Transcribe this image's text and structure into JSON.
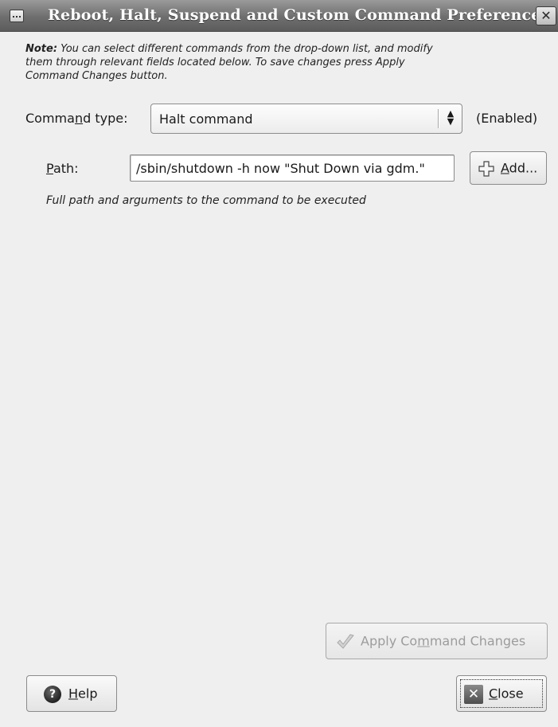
{
  "window": {
    "title": "Reboot, Halt, Suspend and Custom Command Preferences",
    "close_glyph": "✕"
  },
  "note": {
    "bold": "Note:",
    "text": " You can select different commands from the drop-down list, and modify them through relevant fields located below. To save changes press Apply Command Changes button."
  },
  "command_type": {
    "label_pre": "Comma",
    "label_mnemonic": "n",
    "label_post": "d type:",
    "selected": "Halt command",
    "status": "(Enabled)"
  },
  "path": {
    "label_mnemonic": "P",
    "label_post": "ath:",
    "value": "/sbin/shutdown -h now \"Shut Down via gdm.\"",
    "hint": "Full path and arguments to the command to be executed"
  },
  "buttons": {
    "add": {
      "mnemonic": "A",
      "rest": "dd..."
    },
    "apply": {
      "pre": "Apply Co",
      "mnemonic": "m",
      "post": "mand Changes",
      "enabled": false
    },
    "help": {
      "mnemonic": "H",
      "rest": "elp"
    },
    "close": {
      "mnemonic": "C",
      "rest": "lose"
    }
  },
  "icons": {
    "window_menu": "window-menu-icon",
    "add": "plus-icon",
    "apply": "check-icon",
    "help": "question-icon",
    "close": "close-icon"
  }
}
